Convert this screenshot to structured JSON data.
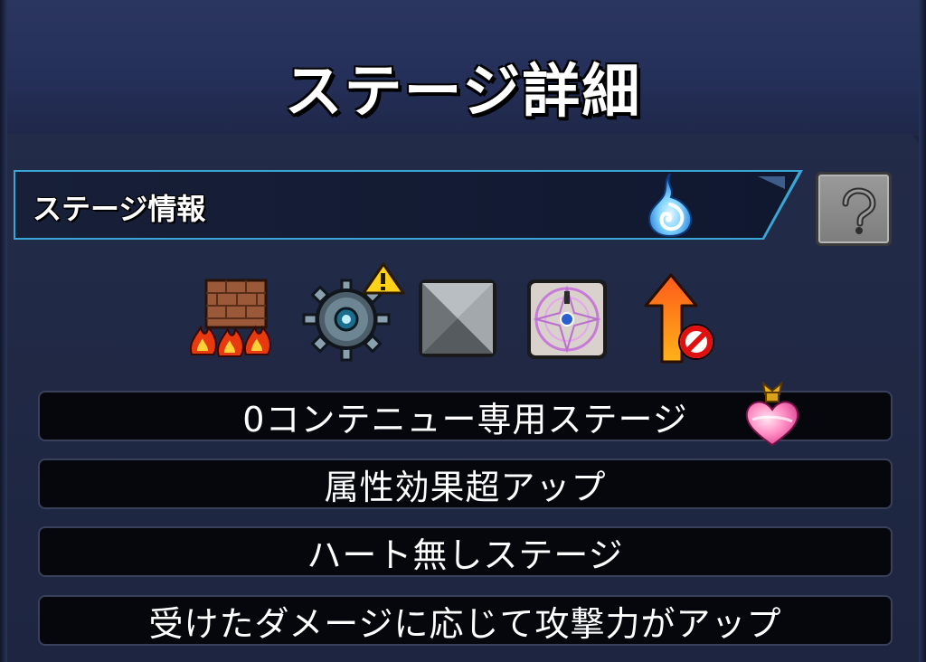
{
  "header": {
    "title": "ステージ詳細"
  },
  "stage_info": {
    "label": "ステージ情報",
    "element_icon": "blue-water-flame-icon",
    "help_icon": "question-mark-icon"
  },
  "gimmicks": [
    {
      "name": "damage-wall-icon"
    },
    {
      "name": "gravity-barrier-mine-icon"
    },
    {
      "name": "block-icon"
    },
    {
      "name": "warp-magic-circle-icon"
    },
    {
      "name": "no-speed-up-icon"
    }
  ],
  "rules": [
    {
      "text": "0コンテニュー専用ステージ",
      "badge": "heart-potion-icon"
    },
    {
      "text": "属性効果超アップ"
    },
    {
      "text": "ハート無しステージ"
    },
    {
      "text": "受けたダメージに応じて攻撃力がアップ"
    }
  ],
  "colors": {
    "background": "#1c2440",
    "accent_border": "#3aa6d6",
    "row_background": "#05070c"
  }
}
